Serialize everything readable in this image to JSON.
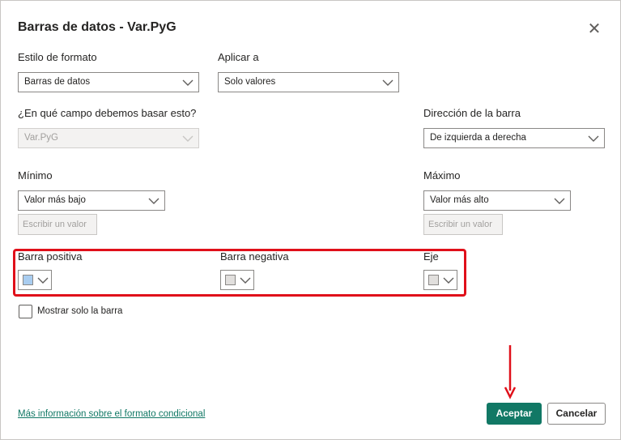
{
  "dialog": {
    "title": "Barras de datos - Var.PyG",
    "close_glyph": "✕"
  },
  "format_style": {
    "label": "Estilo de formato",
    "value": "Barras de datos"
  },
  "apply_to": {
    "label": "Aplicar a",
    "value": "Solo valores"
  },
  "base_field": {
    "label": "¿En qué campo debemos basar esto?",
    "value": "Var.PyG"
  },
  "bar_direction": {
    "label": "Dirección de la barra",
    "value": "De izquierda a derecha"
  },
  "minimum": {
    "label": "Mínimo",
    "value": "Valor más bajo",
    "input_placeholder": "Escribir un valor"
  },
  "maximum": {
    "label": "Máximo",
    "value": "Valor más alto",
    "input_placeholder": "Escribir un valor"
  },
  "colors": {
    "positive": {
      "label": "Barra positiva",
      "color": "#a9cdf0"
    },
    "negative": {
      "label": "Barra negativa",
      "color": "#e1dfdd"
    },
    "axis": {
      "label": "Eje",
      "color": "#e1dfdd"
    }
  },
  "show_bar_only": {
    "label": "Mostrar solo la barra",
    "checked": false
  },
  "footer": {
    "link": "Más información sobre el formato condicional",
    "ok_label": "Aceptar",
    "cancel_label": "Cancelar"
  },
  "theme": {
    "accent": "#117865",
    "highlight": "#e0101a"
  }
}
